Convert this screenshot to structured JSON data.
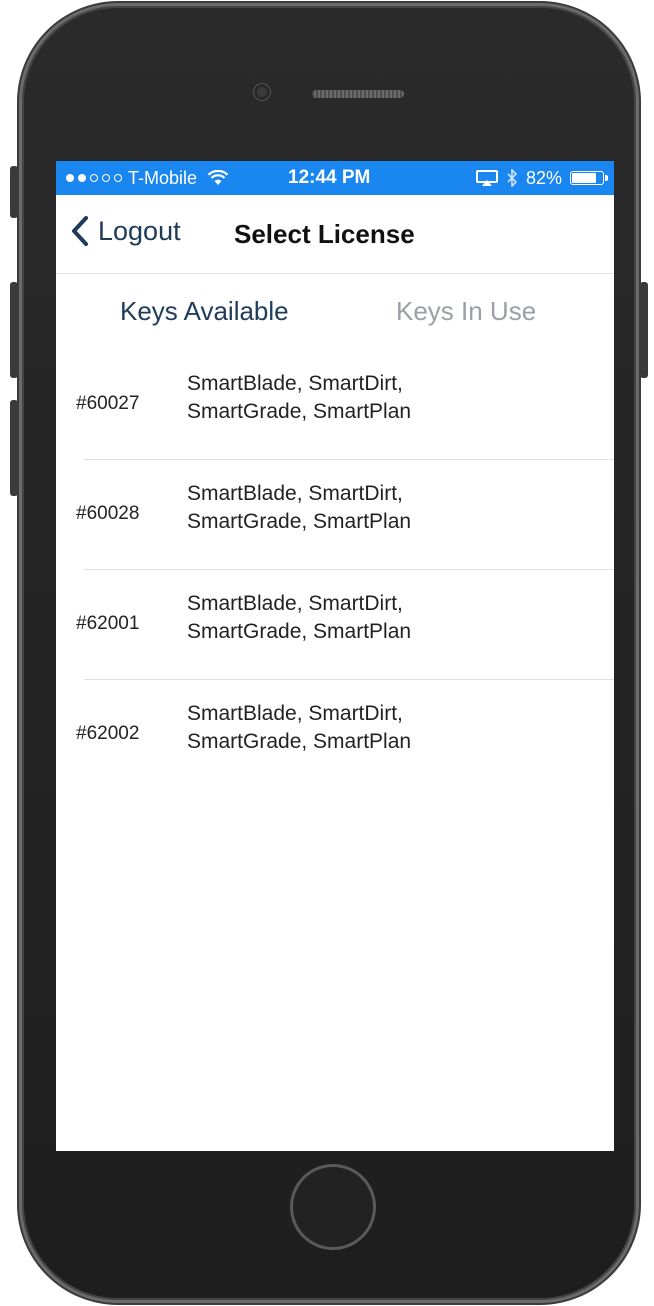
{
  "status_bar": {
    "carrier": "T-Mobile",
    "time": "12:44 PM",
    "battery": "82%",
    "battery_level": 0.82,
    "icons": [
      "signal-dots-icon",
      "wifi-icon",
      "airplay-icon",
      "bluetooth-icon",
      "battery-icon"
    ]
  },
  "nav": {
    "back_label": "Logout",
    "title": "Select License"
  },
  "tabs": [
    {
      "label": "Keys Available",
      "active": true
    },
    {
      "label": "Keys In Use",
      "active": false
    }
  ],
  "licenses": [
    {
      "key": "#60027",
      "modules_line1": "SmartBlade, SmartDirt,",
      "modules_line2": "SmartGrade, SmartPlan"
    },
    {
      "key": "#60028",
      "modules_line1": "SmartBlade, SmartDirt,",
      "modules_line2": "SmartGrade, SmartPlan"
    },
    {
      "key": "#62001",
      "modules_line1": "SmartBlade, SmartDirt,",
      "modules_line2": "SmartGrade, SmartPlan"
    },
    {
      "key": "#62002",
      "modules_line1": "SmartBlade, SmartDirt,",
      "modules_line2": "SmartGrade, SmartPlan"
    }
  ],
  "colors": {
    "status_bar": "#1a86f0",
    "accent": "#1e3b5a",
    "inactive_tab": "#9aa0a6"
  }
}
